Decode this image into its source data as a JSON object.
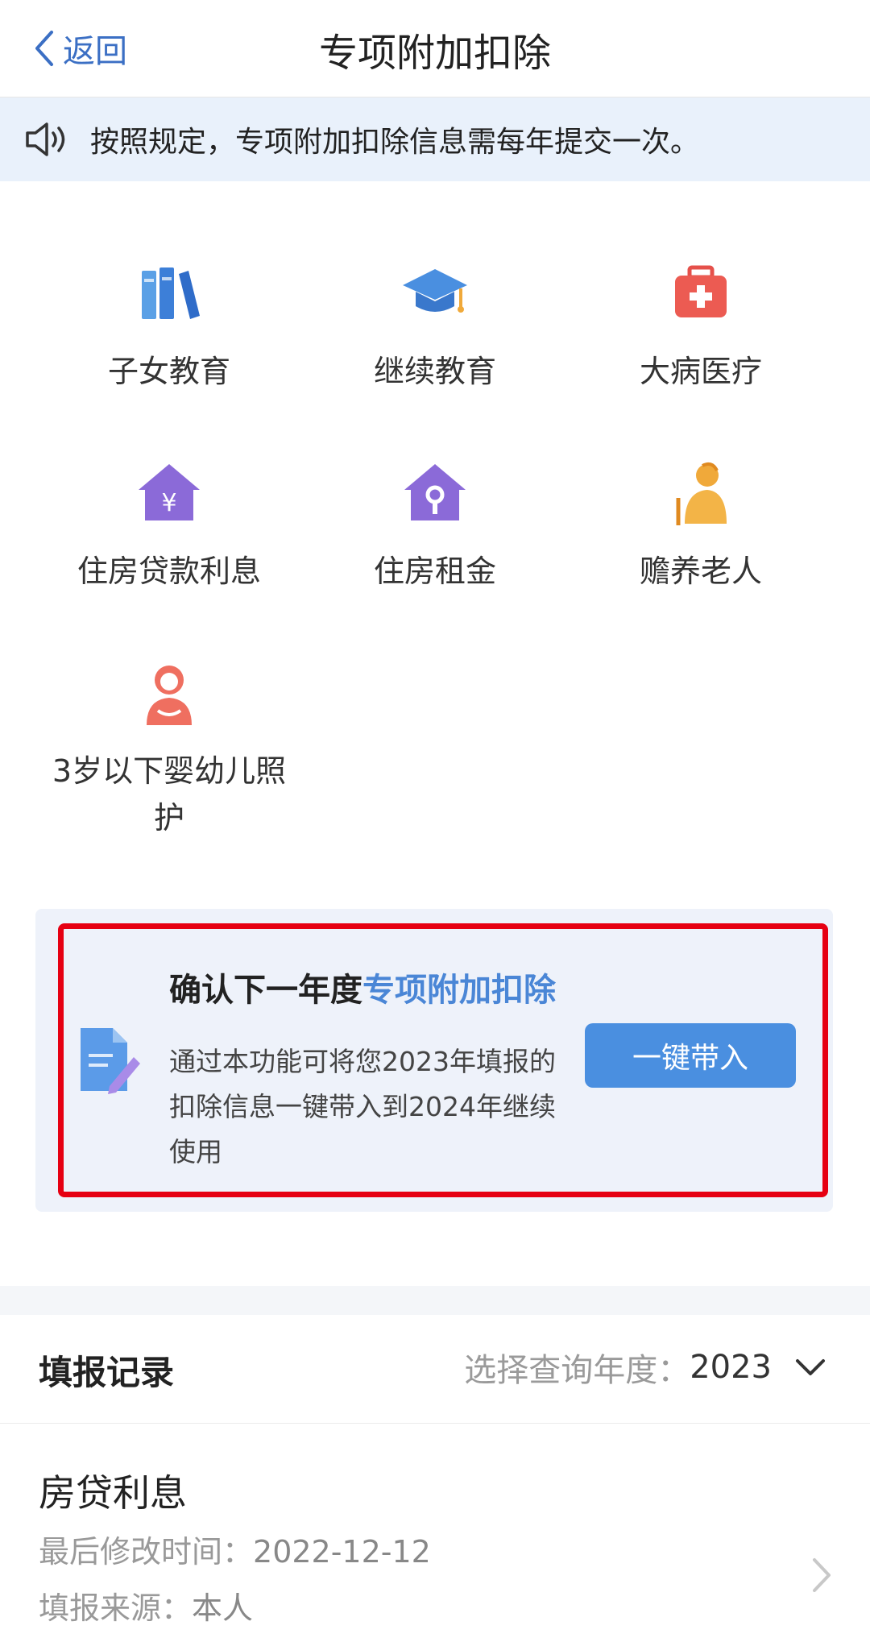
{
  "header": {
    "back_label": "返回",
    "title": "专项附加扣除"
  },
  "notice": {
    "text": "按照规定，专项附加扣除信息需每年提交一次。"
  },
  "categories": [
    {
      "label": "子女教育",
      "icon": "books-icon"
    },
    {
      "label": "继续教育",
      "icon": "graduation-cap-icon"
    },
    {
      "label": "大病医疗",
      "icon": "medical-kit-icon"
    },
    {
      "label": "住房贷款利息",
      "icon": "house-yuan-icon"
    },
    {
      "label": "住房租金",
      "icon": "house-key-icon"
    },
    {
      "label": "赡养老人",
      "icon": "elderly-person-icon"
    },
    {
      "label": "3岁以下婴幼儿照\n护",
      "icon": "mother-icon"
    }
  ],
  "confirm_card": {
    "title_prefix": "确认下一年度",
    "title_highlight": "专项附加扣除",
    "description": "通过本功能可将您2023年填报的扣除信息一键带入到2024年继续使用",
    "button_label": "一键带入"
  },
  "records": {
    "title": "填报记录",
    "year_label": "选择查询年度：",
    "year_value": "2023",
    "items": [
      {
        "name": "房贷利息",
        "modified_label": "最后修改时间：",
        "modified_value": "2022-12-12",
        "source_label": "填报来源：",
        "source_value": "本人"
      }
    ]
  },
  "colors": {
    "accent": "#4a8fe0",
    "highlight": "#e60012",
    "notice_bg": "#e9f1fb"
  }
}
